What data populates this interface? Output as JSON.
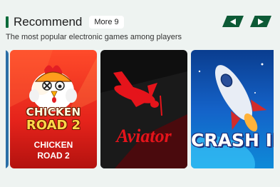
{
  "header": {
    "title": "Recommend",
    "more_label": "More 9",
    "subtitle": "The most popular electronic games among players"
  },
  "nav": {
    "prev_icon": "chevron-left-icon",
    "next_icon": "chevron-right-icon"
  },
  "games": [
    {
      "logo_line1": "CHICKEN",
      "logo_line2": "ROAD 2",
      "caption_line1": "CHICKEN",
      "caption_line2": "ROAD 2"
    },
    {
      "logo": "Aviator"
    },
    {
      "logo": "CRASH II"
    }
  ],
  "colors": {
    "accent": "#0b6b3a",
    "nav": "#0d5a36",
    "background": "#eef3f1"
  }
}
